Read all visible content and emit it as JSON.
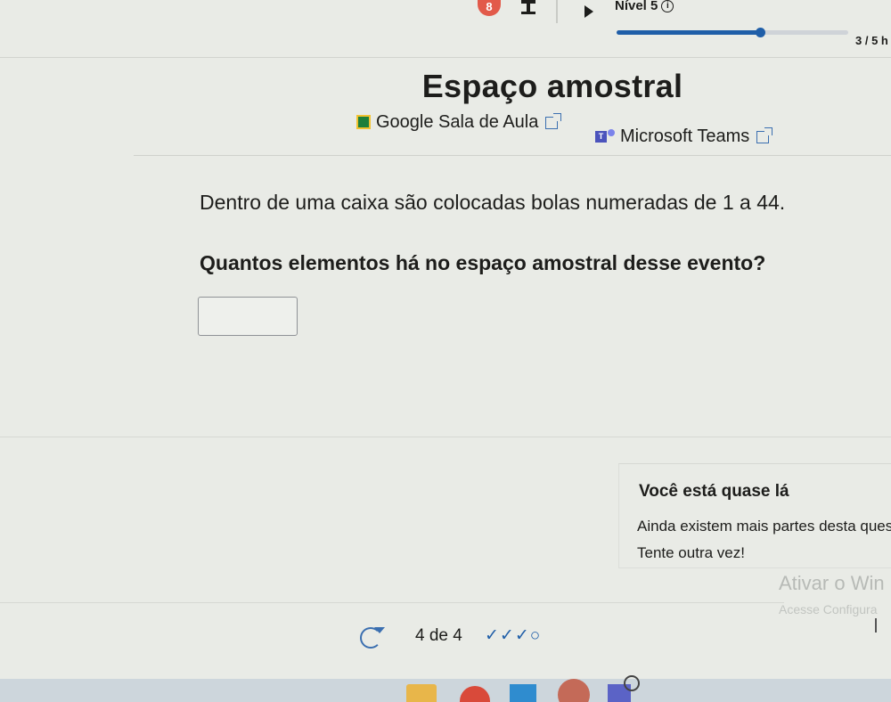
{
  "topbar": {
    "badge_count": "8",
    "level_label": "Nível 5",
    "info_glyph": "i",
    "progress_text": "3 / 5 h",
    "progress_value": 0.62
  },
  "header": {
    "title": "Espaço amostral",
    "share": [
      {
        "label": "Google Sala de Aula",
        "icon": "google-classroom-icon"
      },
      {
        "label": "Microsoft Teams",
        "icon": "microsoft-teams-icon"
      }
    ]
  },
  "exercise": {
    "statement": "Dentro de uma caixa são colocadas bolas numeradas de 1 a 44.",
    "question": "Quantos elementos há no espaço amostral desse evento?",
    "answer_value": ""
  },
  "feedback": {
    "title": "Você está quase lá",
    "line1": "Ainda existem mais partes desta ques",
    "line2": "Tente outra vez!"
  },
  "watermark": {
    "title": "Ativar o Win",
    "subtitle": "Acesse Configura"
  },
  "footer": {
    "attempts": "4 de 4",
    "checks": "✓✓✓○"
  },
  "colors": {
    "accent": "#1f5ea8",
    "badge": "#e25a4a",
    "background": "#e9ebe6"
  }
}
